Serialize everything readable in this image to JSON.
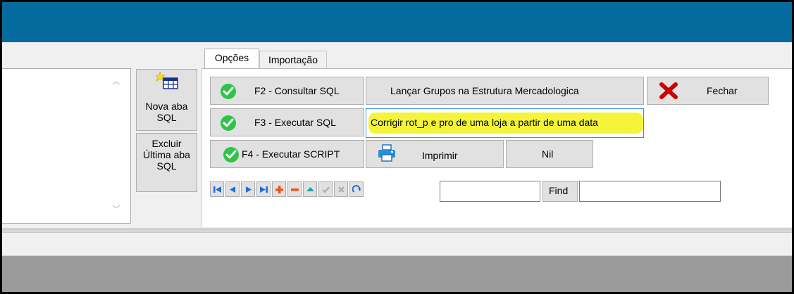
{
  "colors": {
    "titlebar": "#056a9e",
    "highlight": "#f4f53a",
    "check": "#2ec44a",
    "close_x": "#cc0000"
  },
  "sidebar": {
    "new_tab_label_1": "Nova aba",
    "new_tab_label_2": "SQL",
    "delete_tab_label_1": "Excluir",
    "delete_tab_label_2": "Última aba",
    "delete_tab_label_3": "SQL"
  },
  "tabs": [
    {
      "label": "Opções",
      "active": true
    },
    {
      "label": "Importação",
      "active": false
    }
  ],
  "buttons": {
    "consultar": "F2 - Consultar SQL",
    "executar": "F3 - Executar SQL",
    "script": "F4 - Executar SCRIPT",
    "lancar": "Lançar Grupos na Estrutura Mercadologica",
    "fechar": "Fechar",
    "corrigir": "Corrigir rot_p e pro de uma loja a partir de uma data",
    "imprimir": "Imprimir",
    "nil": "Nil",
    "find": "Find"
  },
  "navigator": [
    "first-icon",
    "prior-icon",
    "next-icon",
    "last-icon",
    "insert-icon",
    "delete-icon",
    "edit-icon",
    "post-icon",
    "cancel-icon",
    "refresh-icon"
  ],
  "find_input_value": "",
  "search_input_value": ""
}
